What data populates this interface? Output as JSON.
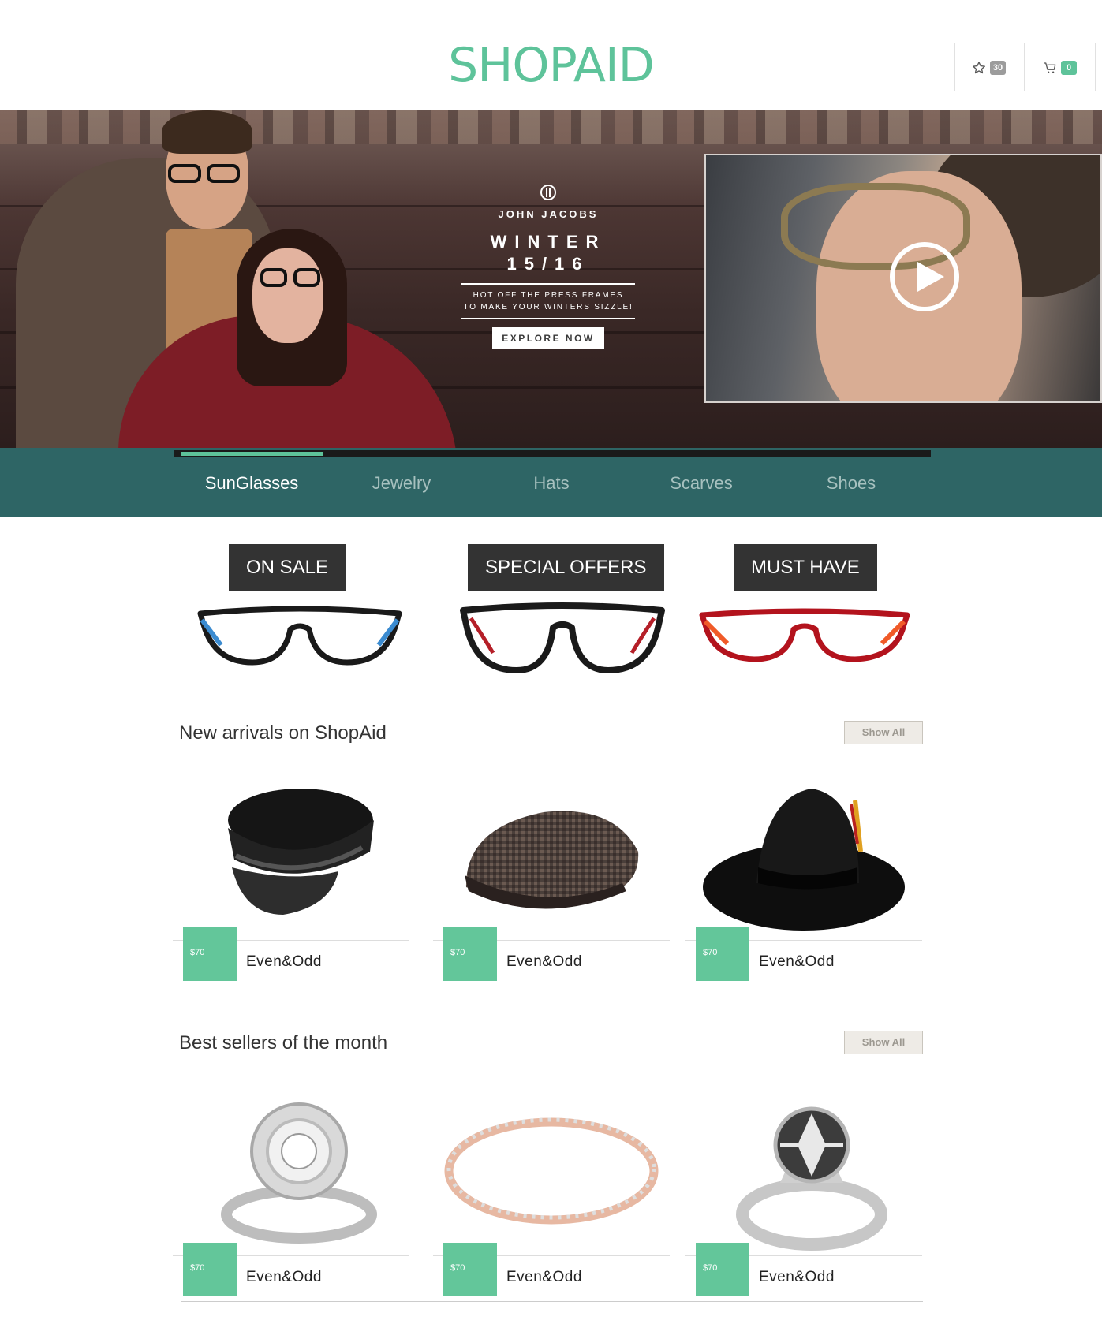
{
  "header": {
    "logo": "SHOPAID",
    "wishlist_count": "30",
    "cart_count": "0"
  },
  "hero": {
    "brand": "JOHN JACOBS",
    "title_line1": "WINTER",
    "title_line2": "15/16",
    "subtitle_line1": "HOT OFF THE PRESS FRAMES",
    "subtitle_line2": "TO MAKE YOUR WINTERS SIZZLE!",
    "cta": "EXPLORE NOW"
  },
  "categories": [
    {
      "label": "SunGlasses",
      "active": true
    },
    {
      "label": "Jewelry",
      "active": false
    },
    {
      "label": "Hats",
      "active": false
    },
    {
      "label": "Scarves",
      "active": false
    },
    {
      "label": "Shoes",
      "active": false
    }
  ],
  "promos": [
    {
      "label": "ON SALE",
      "frame_color": "#1a1a1a",
      "accent_color": "#3b8bd0"
    },
    {
      "label": "SPECIAL OFFERS",
      "frame_color": "#1a1a1a",
      "accent_color": "#b51f28"
    },
    {
      "label": "MUST HAVE",
      "frame_color": "#b3131d",
      "accent_color": "#f05a28"
    }
  ],
  "new_arrivals": {
    "title": "New arrivals on ShopAid",
    "show_all": "Show All",
    "items": [
      {
        "price": "$70",
        "name": "Even&Odd",
        "icon": "captain-hat-icon"
      },
      {
        "price": "$70",
        "name": "Even&Odd",
        "icon": "flat-cap-icon"
      },
      {
        "price": "$70",
        "name": "Even&Odd",
        "icon": "fedora-hat-icon"
      }
    ]
  },
  "best_sellers": {
    "title": "Best sellers of the month",
    "show_all": "Show All",
    "items": [
      {
        "price": "$70",
        "name": "Even&Odd",
        "icon": "halo-ring-icon"
      },
      {
        "price": "$70",
        "name": "Even&Odd",
        "icon": "band-ring-icon"
      },
      {
        "price": "$70",
        "name": "Even&Odd",
        "icon": "solitaire-ring-icon"
      }
    ]
  },
  "colors": {
    "brand": "#5ec39a",
    "nav_bg": "#2e6565",
    "price_tag": "#63c69a"
  }
}
